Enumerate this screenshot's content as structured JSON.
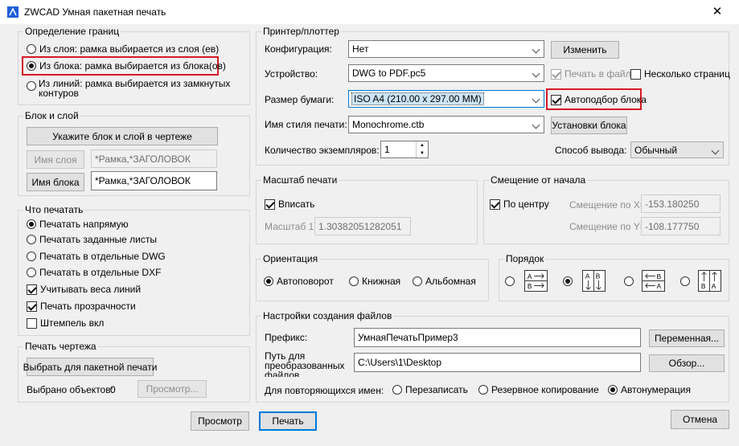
{
  "window": {
    "title": "ZWCAD Умная пакетная печать",
    "close_icon": "close-icon"
  },
  "boundary": {
    "group_label": "Определение границ",
    "options": [
      {
        "label": "Из слоя: рамка выбирается из слоя (ев)",
        "selected": false
      },
      {
        "label": "Из блока: рамка выбирается из блока(ов)",
        "selected": true
      },
      {
        "label": "Из линий: рамка выбирается из замкнутых контуров",
        "selected": false
      }
    ]
  },
  "block_layer": {
    "group_label": "Блок и слой",
    "pick_button": "Укажите блок и слой в чертеже",
    "layer_name_button": "Имя слоя",
    "layer_name_value": "*Рамка,*ЗАГОЛОВОК",
    "block_name_button": "Имя блока",
    "block_name_value": "*Рамка,*ЗАГОЛОВОК"
  },
  "what_to_print": {
    "group_label": "Что печатать",
    "radios": [
      {
        "label": "Печатать напрямую",
        "selected": true
      },
      {
        "label": "Печатать заданные листы",
        "selected": false
      },
      {
        "label": "Печатать в отдельные DWG",
        "selected": false
      },
      {
        "label": "Печатать в отдельные DXF",
        "selected": false
      }
    ],
    "checks": [
      {
        "label": "Учитывать веса линий",
        "checked": true
      },
      {
        "label": "Печать прозрачности",
        "checked": true
      },
      {
        "label": "Штемпель вкл",
        "checked": false
      }
    ]
  },
  "drawing_print": {
    "group_label": "Печать чертежа",
    "select_button": "Выбрать для пакетной печати",
    "selected_label": "Выбрано объектов:",
    "selected_count": "0",
    "preview_button": "Просмотр..."
  },
  "printer": {
    "group_label": "Принтер/плоттер",
    "config_label": "Конфигурация:",
    "config_value": "Нет",
    "change_button": "Изменить",
    "device_label": "Устройство:",
    "device_value": "DWG to PDF.pc5",
    "print_to_file_label": "Печать в файл",
    "print_to_file_checked": true,
    "multi_pages_label": "Несколько страниц",
    "multi_pages_checked": false,
    "paper_label": "Размер бумаги:",
    "paper_value": "ISO A4 (210.00 x 297.00 MM)",
    "auto_fit_label": "Автоподбор блока",
    "auto_fit_checked": true,
    "style_label": "Имя стиля печати:",
    "style_value": "Monochrome.ctb",
    "block_settings_button": "Установки блока",
    "copies_label": "Количество экземпляров:",
    "copies_value": "1",
    "output_label": "Способ вывода:",
    "output_value": "Обычный"
  },
  "scale": {
    "group_label": "Масштаб печати",
    "fit_label": "Вписать",
    "fit_checked": true,
    "scale_label": "Масштаб 1:",
    "scale_value": "1.30382051282051"
  },
  "offset": {
    "group_label": "Смещение от начала",
    "center_label": "По центру",
    "center_checked": true,
    "x_label": "Смещение по X=",
    "x_value": "-153.180250",
    "y_label": "Смещение по Y=",
    "y_value": "-108.177750"
  },
  "orientation": {
    "group_label": "Ориентация",
    "options": [
      {
        "label": "Автоповорот",
        "selected": true
      },
      {
        "label": "Книжная",
        "selected": false
      },
      {
        "label": "Альбомная",
        "selected": false
      }
    ]
  },
  "order": {
    "group_label": "Порядок",
    "options": [
      {
        "icon": "order-rows-right-icon",
        "text": "A→ B→",
        "selected": false
      },
      {
        "icon": "order-cols-down-icon",
        "text": "A↓ B↓",
        "selected": true
      },
      {
        "icon": "order-rows-left-icon",
        "text": "←B ←A",
        "selected": false
      },
      {
        "icon": "order-cols-up-icon",
        "text": "A↑ B↑",
        "selected": false
      }
    ]
  },
  "files": {
    "group_label": "Настройки создания файлов",
    "prefix_label": "Префикс:",
    "prefix_value": "УмнаяПечатьПример3",
    "variable_button": "Переменная...",
    "path_label": "Путь для преобразованных файлов",
    "path_value": "C:\\Users\\1\\Desktop",
    "browse_button": "Обзор...",
    "duplicates_label": "Для повторяющихся имен:",
    "duplicate_options": [
      {
        "label": "Перезаписать",
        "selected": false
      },
      {
        "label": "Резервное копирование",
        "selected": false
      },
      {
        "label": "Автонумерация",
        "selected": true
      }
    ]
  },
  "footer": {
    "preview_button": "Просмотр",
    "print_button": "Печать",
    "cancel_button": "Отмена"
  },
  "colors": {
    "highlight": "#d41c25",
    "accent": "#0078d7"
  }
}
